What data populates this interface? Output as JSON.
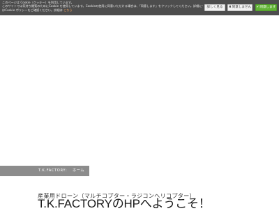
{
  "cookie_banner": {
    "lines": [
      "このページは Cookie（クッキー）を利用しています。",
      "このサイトでは気持ち閲覧のためにCookie を使用しています。Cookieの使用に同意いただける場合は、「同意します」をクリックしてください。詳細について",
      "はCookie ポリシーをご確認ください。詳細は"
    ],
    "link_label": "こちら",
    "settings_label": "詳しく見る",
    "reject_label": "同意しません",
    "accept_label": "同意します",
    "reject_icon": "close-icon",
    "accept_icon": "check-icon",
    "accent_color": "#62b336"
  },
  "breadcrumb": {
    "site": "T.K.FACTORY",
    "separator": ":",
    "current": "ホーム"
  },
  "hero": {
    "subtitle": "産業用ドローン（マルチコプター・ラジコンヘリコプター）",
    "title": "T.K.FACTORYのHPへようこそ！"
  }
}
